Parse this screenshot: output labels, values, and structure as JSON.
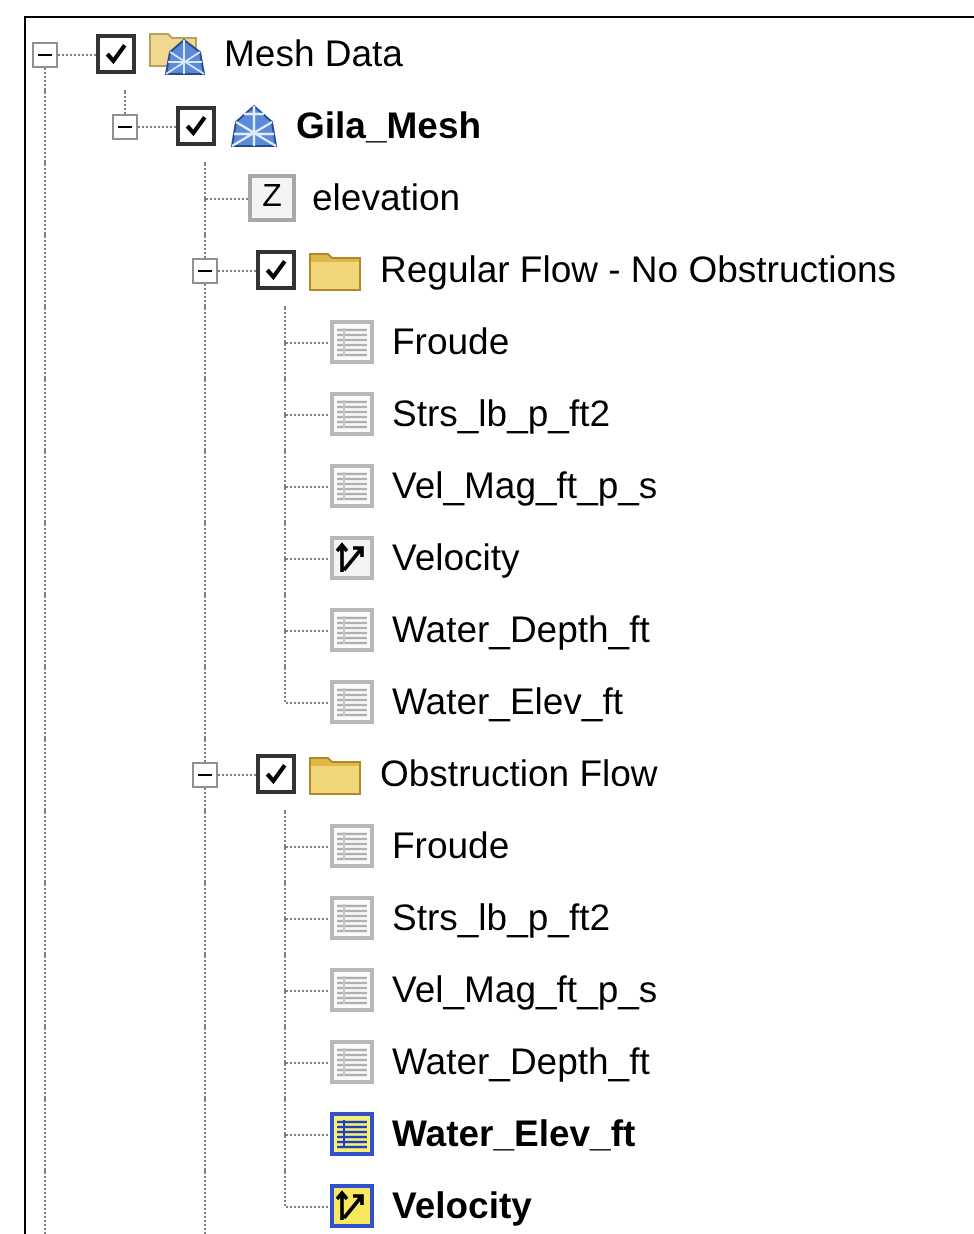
{
  "tree": [
    {
      "label": "Mesh Data",
      "kind": "mesh_folder",
      "checked": true,
      "expanded": true,
      "active": false,
      "more_below": true,
      "children": [
        {
          "label": "Gila_Mesh",
          "kind": "mesh",
          "checked": true,
          "expanded": true,
          "active": true,
          "children": [
            {
              "label": "elevation",
              "kind": "elevation",
              "icon_text": "Z",
              "active": false
            },
            {
              "label": "Regular Flow - No Obstructions",
              "kind": "folder",
              "checked": true,
              "expanded": true,
              "active": false,
              "children": [
                {
                  "label": "Froude",
                  "kind": "scalar",
                  "active": false
                },
                {
                  "label": "Strs_lb_p_ft2",
                  "kind": "scalar",
                  "active": false
                },
                {
                  "label": "Vel_Mag_ft_p_s",
                  "kind": "scalar",
                  "active": false
                },
                {
                  "label": "Velocity",
                  "kind": "vector",
                  "active": false
                },
                {
                  "label": "Water_Depth_ft",
                  "kind": "scalar",
                  "active": false
                },
                {
                  "label": "Water_Elev_ft",
                  "kind": "scalar",
                  "active": false
                }
              ]
            },
            {
              "label": "Obstruction Flow",
              "kind": "folder",
              "checked": true,
              "expanded": true,
              "active": false,
              "more_below": true,
              "children": [
                {
                  "label": "Froude",
                  "kind": "scalar",
                  "active": false
                },
                {
                  "label": "Strs_lb_p_ft2",
                  "kind": "scalar",
                  "active": false
                },
                {
                  "label": "Vel_Mag_ft_p_s",
                  "kind": "scalar",
                  "active": false
                },
                {
                  "label": "Water_Depth_ft",
                  "kind": "scalar",
                  "active": false
                },
                {
                  "label": "Water_Elev_ft",
                  "kind": "scalar",
                  "active": true
                },
                {
                  "label": "Velocity",
                  "kind": "vector",
                  "active": true
                }
              ]
            }
          ]
        }
      ]
    }
  ]
}
